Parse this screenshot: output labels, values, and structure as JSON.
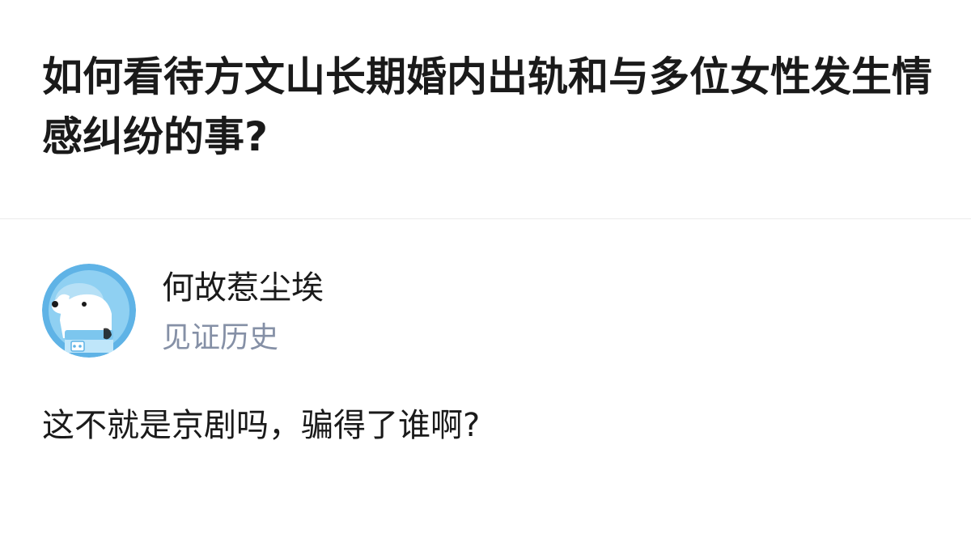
{
  "question": {
    "title": "如何看待方文山长期婚内出轨和与多位女性发生情感纠纷的事?"
  },
  "answer": {
    "author": {
      "name": "何故惹尘埃",
      "badge": "见证历史",
      "avatar_icon": "cartoon-dog-astronaut-avatar"
    },
    "content": "这不就是京剧吗，骗得了谁啊?"
  },
  "colors": {
    "title_text": "#1a1a1a",
    "body_text": "#1a1a1a",
    "badge_text": "#8590a6",
    "divider": "#ebebeb",
    "avatar_background": "#5fb3e6"
  }
}
